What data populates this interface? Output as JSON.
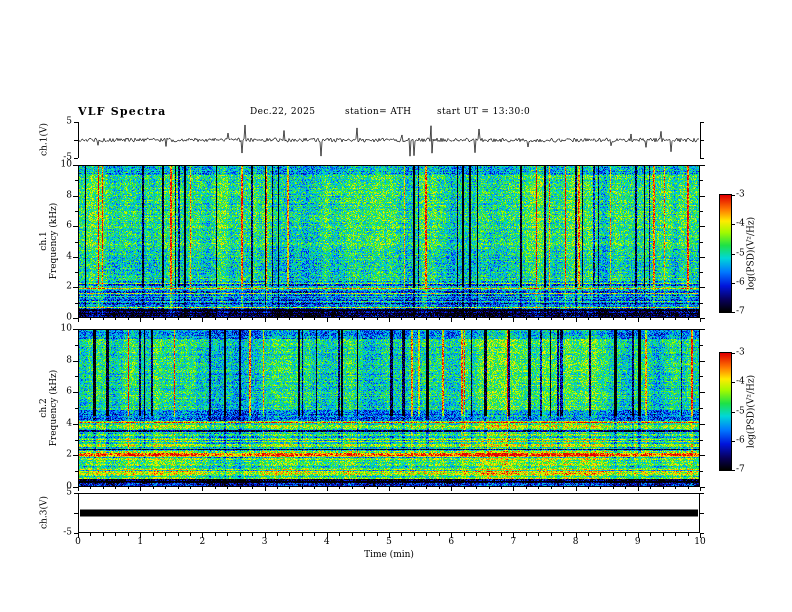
{
  "header": {
    "title": "VLF Spectra",
    "date": "Dec.22, 2025",
    "station": "station= ATH",
    "start_ut": "start UT =   13:30:0"
  },
  "panels": {
    "wave1": {
      "name": "ch.1(V)",
      "ytop": "5",
      "ybottom": "-5"
    },
    "spec1": {
      "channel": "ch.1",
      "ylabel": "Frequency (kHz)",
      "yticks": [
        "10",
        "8",
        "6",
        "4",
        "2",
        "0"
      ]
    },
    "spec2": {
      "channel": "ch.2",
      "ylabel": "Frequency (kHz)",
      "yticks": [
        "10",
        "8",
        "6",
        "4",
        "2",
        "0"
      ]
    },
    "wave3": {
      "name": "ch.3(V)",
      "ytop": "5",
      "ybottom": "-5"
    }
  },
  "xaxis": {
    "label": "Time (min)",
    "ticks": [
      "0",
      "1",
      "2",
      "3",
      "4",
      "5",
      "6",
      "7",
      "8",
      "9",
      "10"
    ]
  },
  "colorbars": {
    "label": "log(PSD)(V²/Hz)",
    "ticks": [
      "-3",
      "-4",
      "-5",
      "-6",
      "-7"
    ]
  },
  "chart_data": [
    {
      "type": "line",
      "panel": "ch.1(V) waveform",
      "xlim_min": [
        0,
        10
      ],
      "ylim_V": [
        -5,
        5
      ],
      "description": "Broadband noisy voltage trace centered near 0 V with frequent impulsive spikes reaching toward ±5 V across the full 10 minutes."
    },
    {
      "type": "heatmap",
      "panel": "ch.1 spectrogram",
      "xlabel": "Time (min)",
      "ylabel": "Frequency (kHz)",
      "xlim_min": [
        0,
        10
      ],
      "ylim_kHz": [
        0,
        10
      ],
      "zlabel": "log(PSD)(V²/Hz)",
      "zlim": [
        -7,
        -3
      ],
      "description": "Dense speckle, mostly green/cyan (~ -5) above 2 kHz with many vertical dark-blue/black dropout streaks and sporadic red (~ -3.5) burst columns; darker blue band 0.5-2 kHz; near-black horizontal band below ~0.5 kHz with thin bright horizontal lines near the bottom."
    },
    {
      "type": "heatmap",
      "panel": "ch.2 spectrogram",
      "xlabel": "Time (min)",
      "ylabel": "Frequency (kHz)",
      "xlim_min": [
        0,
        10
      ],
      "ylim_kHz": [
        0,
        10
      ],
      "zlabel": "log(PSD)(V²/Hz)",
      "zlim": [
        -7,
        -3
      ],
      "description": "Green/cyan speckle with strong vertical dark streaks above ~4.5 kHz; a darker band near 4.2-4.8 kHz; below 4 kHz dominated by bright yellow-green horizontal banding with a reddish line near 2 kHz; near-black band below ~0.4 kHz."
    },
    {
      "type": "line",
      "panel": "ch.3(V) waveform",
      "xlim_min": [
        0,
        10
      ],
      "ylim_V": [
        -5,
        5
      ],
      "description": "Saturated flat trace rendered as a thick solid black bar at about 0 V for the entire record."
    }
  ]
}
